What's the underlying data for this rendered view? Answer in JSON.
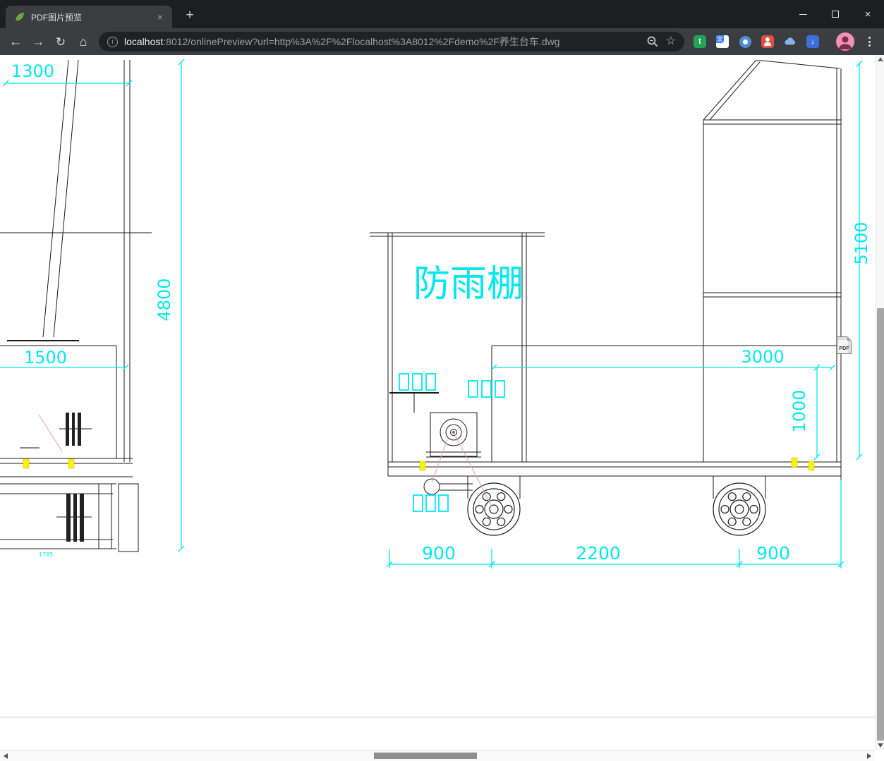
{
  "browser": {
    "tab_title": "PDF图片预览",
    "tab_close_glyph": "×",
    "new_tab_glyph": "+",
    "nav": {
      "back_glyph": "←",
      "forward_glyph": "→",
      "reload_glyph": "↻",
      "home_glyph": "⌂"
    },
    "omnibox": {
      "info_glyph": "i",
      "host": "localhost",
      "path": ":8012/onlinePreview?url=http%3A%2F%2Flocalhost%3A8012%2Fdemo%2F养生台车.dwg",
      "star_glyph": "☆"
    },
    "window_glyphs": {
      "close": "×"
    },
    "ext_glyphs": {
      "green": "t",
      "translate": "文",
      "blue_arrow": "↓"
    }
  },
  "drawing": {
    "canopy_label": "防雨棚",
    "dims": {
      "d1300": "1300",
      "d4800": "4800",
      "d1500": "1500",
      "d1785": "1785",
      "d5100": "5100",
      "d3000": "3000",
      "d1000": "1000",
      "d900_left": "900",
      "d2200": "2200",
      "d900_right": "900"
    },
    "colors": {
      "dimension_cyan": "#00e8ee",
      "line_black": "#1b1b1b",
      "highlight_yellow": "#fff200",
      "leader_pink": "#dfa3ad"
    }
  },
  "pdf_badge_label": "PDF"
}
